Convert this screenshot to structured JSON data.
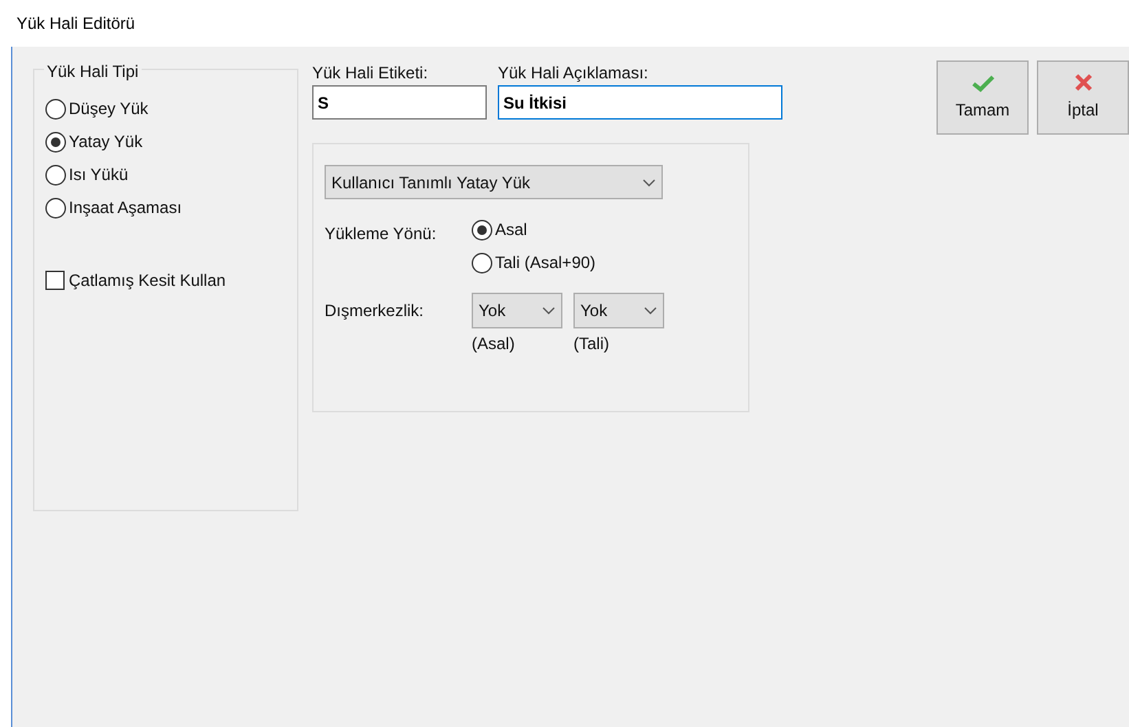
{
  "window": {
    "title": "Yük Hali Editörü"
  },
  "load_type_group": {
    "title": "Yük Hali Tipi",
    "options": [
      {
        "label": "Düşey Yük",
        "selected": false
      },
      {
        "label": "Yatay Yük",
        "selected": true
      },
      {
        "label": "Isı Yükü",
        "selected": false
      },
      {
        "label": "Inşaat Aşaması",
        "selected": false
      }
    ],
    "cracked_section": {
      "label": "Çatlamış Kesit Kullan",
      "checked": false
    }
  },
  "label_field": {
    "label": "Yük Hali Etiketi:",
    "value": "S"
  },
  "description_field": {
    "label": "Yük Hali Açıklaması:",
    "value": "Su İtkisi",
    "focused": true
  },
  "load_panel": {
    "type_dropdown": "Kullanıcı Tanımlı Yatay Yük",
    "direction": {
      "label": "Yükleme Yönü:",
      "options": [
        {
          "label": "Asal",
          "selected": true
        },
        {
          "label": "Tali (Asal+90)",
          "selected": false
        }
      ]
    },
    "eccentricity": {
      "label": "Dışmerkezlik:",
      "dropdowns": [
        {
          "value": "Yok",
          "caption": "(Asal)"
        },
        {
          "value": "Yok",
          "caption": "(Tali)"
        }
      ]
    }
  },
  "buttons": [
    {
      "kind": "ok",
      "label": "Tamam"
    },
    {
      "kind": "cancel",
      "label": "İptal"
    }
  ]
}
